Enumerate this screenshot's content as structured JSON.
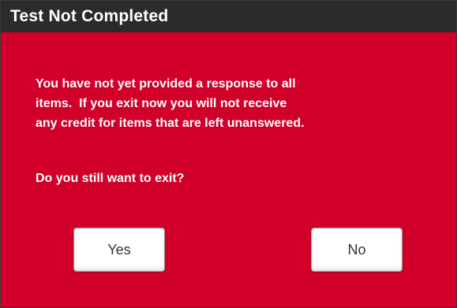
{
  "dialog": {
    "title": "Test Not Completed",
    "message_lines": [
      "You have not yet provided a response to all",
      "items.  If you exit now you will not receive",
      "any credit for items that are left unanswered."
    ],
    "question": "Do you still want to exit?",
    "yes_label": "Yes",
    "no_label": "No"
  },
  "colors": {
    "dialog_background": "#d0002b",
    "titlebar_background": "#2b2b2b",
    "text": "#ffffff",
    "button_background": "#ffffff"
  }
}
